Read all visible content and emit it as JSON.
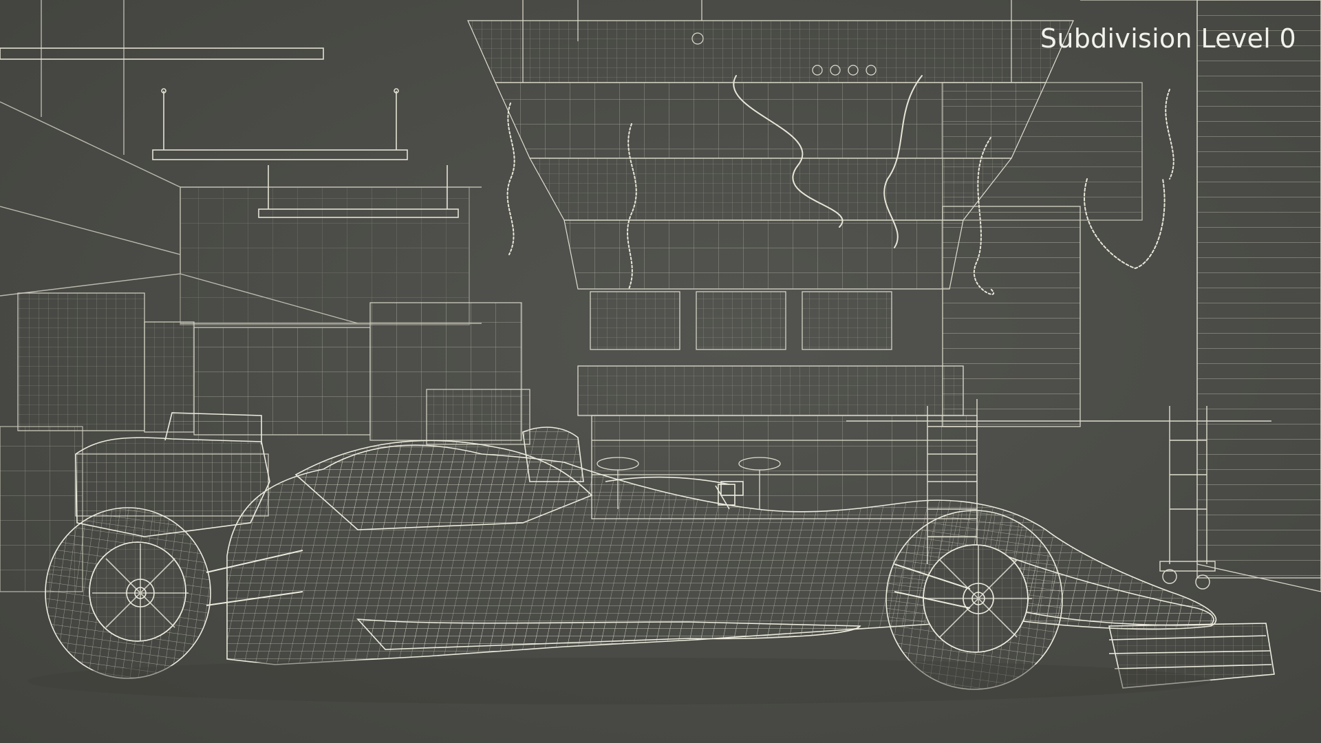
{
  "viewport": {
    "overlay_label": "Subdivision Level 0"
  },
  "colors": {
    "background": "#4a4b46",
    "wireframe": "#e4e2d4",
    "wireframe_dim": "#a9a899",
    "label": "#f2f2ec"
  },
  "scene": {
    "subject": "formula-one-car-wireframe",
    "environment": "pit-garage-wireframe"
  }
}
